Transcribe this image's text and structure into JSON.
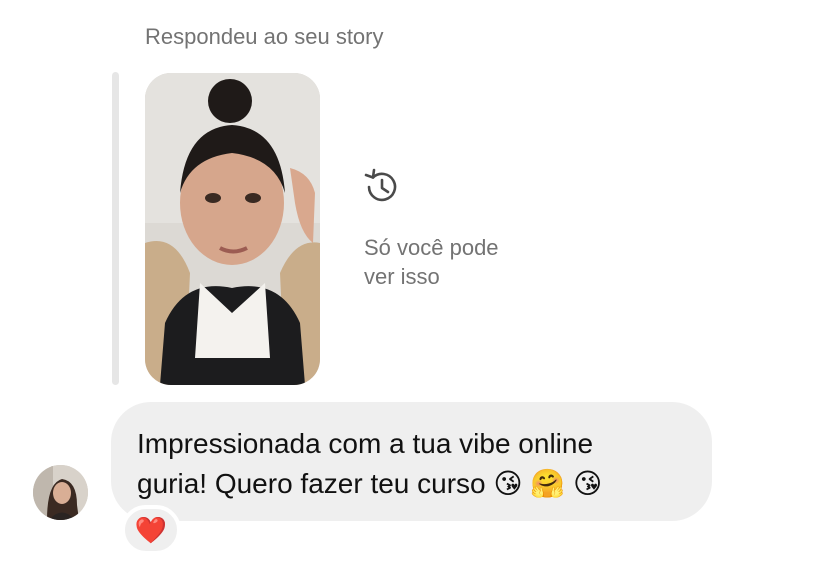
{
  "reply_context": {
    "label": "Respondeu ao seu story"
  },
  "story": {
    "expired_icon": "history-icon",
    "notice_line1": "Só você pode",
    "notice_line2": "ver isso"
  },
  "message": {
    "line1": "Impressionada com a tua vibe online",
    "line2": "guria! Quero fazer teu curso 😘 🤗 😘",
    "reaction": "❤️"
  },
  "colors": {
    "bubble": "#efefef",
    "secondary_text": "#737373",
    "heart": "#e0243a"
  }
}
